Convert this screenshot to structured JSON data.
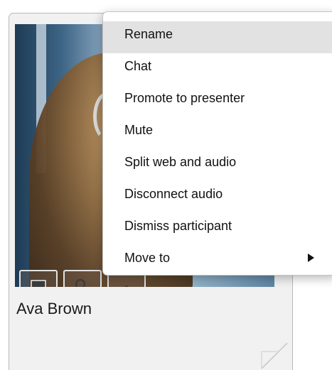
{
  "participant": {
    "name": "Ava Brown",
    "video_buttons": [
      {
        "icon": "chat-bubble-icon"
      },
      {
        "icon": "person-icon"
      },
      {
        "icon": "more-icon"
      }
    ]
  },
  "context_menu": {
    "items": [
      {
        "label": "Rename",
        "highlighted": true
      },
      {
        "label": "Chat",
        "highlighted": false
      },
      {
        "label": "Promote to presenter",
        "highlighted": false
      },
      {
        "label": "Mute",
        "highlighted": false
      },
      {
        "label": "Split web and audio",
        "highlighted": false
      },
      {
        "label": "Disconnect audio",
        "highlighted": false
      },
      {
        "label": "Dismiss participant",
        "highlighted": false
      },
      {
        "label": "Move to",
        "highlighted": false,
        "has_submenu": true
      }
    ]
  },
  "colors": {
    "menu_highlight": "#e2e2e2",
    "card_background": "#f1f1f1",
    "card_border": "#b9b9b9"
  }
}
